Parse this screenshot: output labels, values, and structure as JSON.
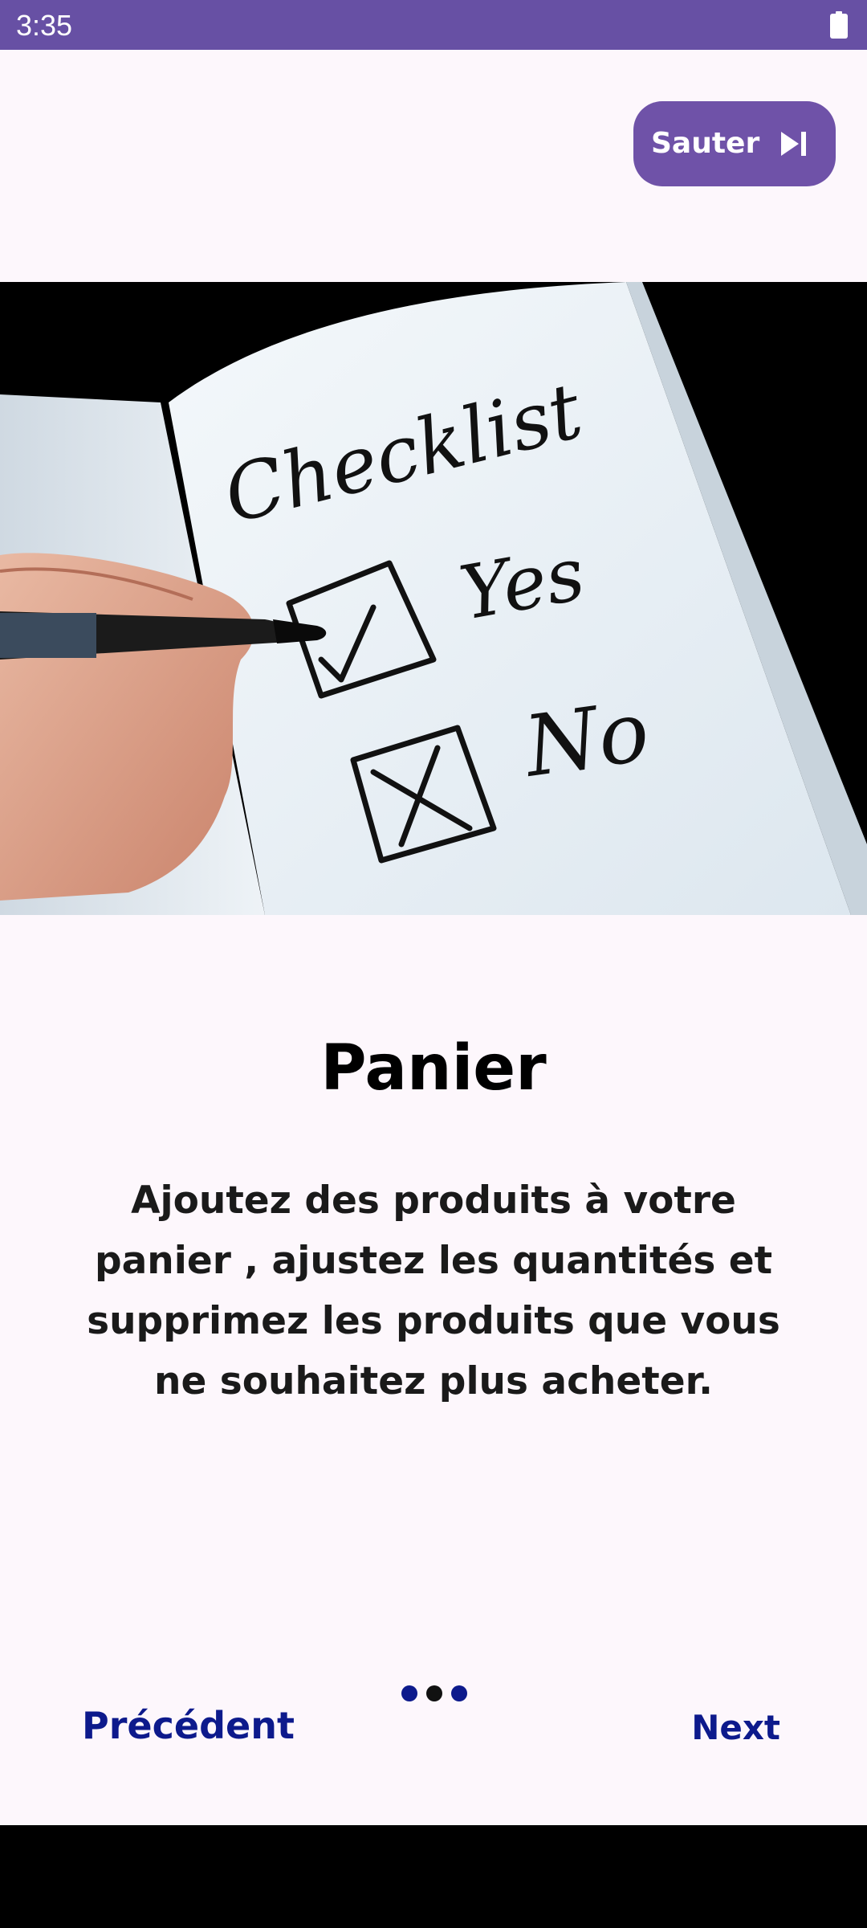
{
  "status_bar": {
    "time": "3:35",
    "battery_icon": "battery-full-icon",
    "color": "#6750a4"
  },
  "skip": {
    "label": "Sauter",
    "icon": "skip-next-icon",
    "color": "#6f52a8"
  },
  "hero": {
    "icon": "checklist-illustration",
    "handwriting": {
      "heading": "Checklist",
      "option_yes": "Yes",
      "option_no": "No"
    }
  },
  "content": {
    "title": "Panier",
    "description": "Ajoutez des produits à votre panier , ajustez les quantités et supprimez les produits que vous ne souhaitez plus acheter."
  },
  "navigation": {
    "previous_label": "Précédent",
    "next_label": "Next",
    "text_color": "#0d1a8c",
    "dots": [
      {
        "color": "#0d1a8c"
      },
      {
        "color": "#111111"
      },
      {
        "color": "#0d1a8c"
      }
    ]
  }
}
